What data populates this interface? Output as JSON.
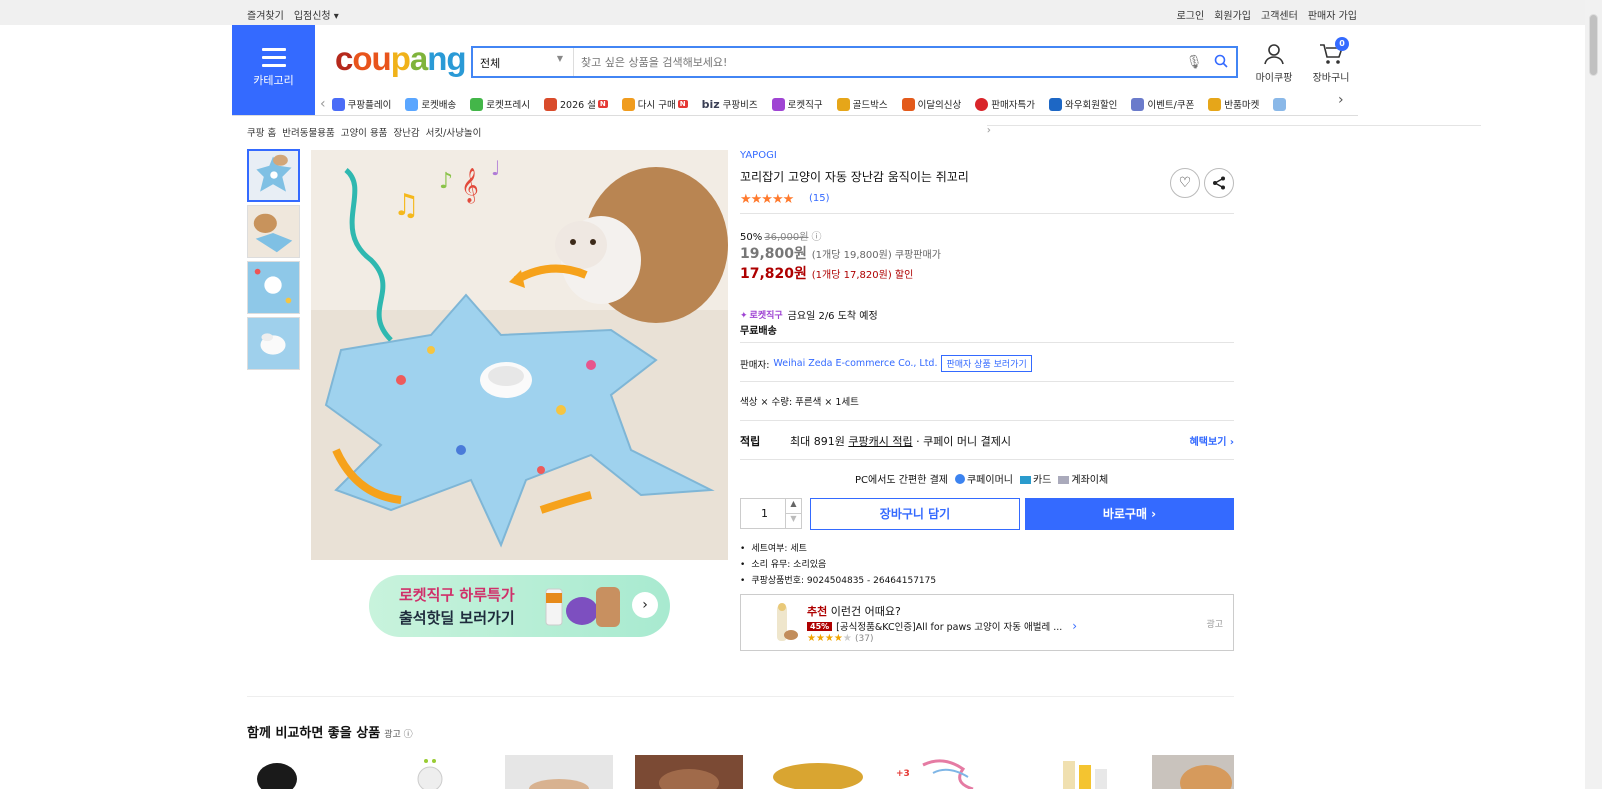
{
  "topbar": {
    "left": [
      "즐겨찾기",
      "입점신청 ▾"
    ],
    "right": [
      "로그인",
      "회원가입",
      "고객센터",
      "판매자 가입"
    ]
  },
  "category": {
    "label": "카테고리"
  },
  "search": {
    "scope": "전체",
    "placeholder": "찾고 싶은 상품을 검색해보세요!"
  },
  "header": {
    "my": "마이쿠팡",
    "cart": "장바구니",
    "cart_count": "0"
  },
  "quicknav": [
    {
      "label": "쿠팡플레이",
      "color": "#4a6cf7"
    },
    {
      "label": "로켓배송",
      "color": "#5aa6ff"
    },
    {
      "label": "로켓프레시",
      "color": "#43b649"
    },
    {
      "label": "2026 설",
      "color": "#d94b2b",
      "badge": "N"
    },
    {
      "label": "다시 구매",
      "color": "#f09c1e",
      "badge": "N"
    },
    {
      "label": "쿠팡비즈",
      "color": "#3a3f55",
      "prefix": "biz"
    },
    {
      "label": "로켓직구",
      "color": "#9f44d3"
    },
    {
      "label": "골드박스",
      "color": "#e6a619"
    },
    {
      "label": "이달의신상",
      "color": "#e35a1b"
    },
    {
      "label": "판매자특가",
      "color": "#d9252a"
    },
    {
      "label": "와우회원할인",
      "color": "#1d67c5"
    },
    {
      "label": "이벤트/쿠폰",
      "color": "#6b7bcb"
    },
    {
      "label": "반품마켓",
      "color": "#e6a619"
    }
  ],
  "breadcrumb": [
    "쿠팡 홈",
    "반려동물용품",
    "고양이 용품",
    "장난감",
    "서킷/사냥놀이"
  ],
  "promo": {
    "line1": "로켓직구 하루특가",
    "line2": "출석핫딜 보러가기"
  },
  "product": {
    "brand": "YAPOGI",
    "title": "꼬리잡기 고양이 자동 장난감 움직이는 쥐꼬리",
    "stars": "★★★★★",
    "review_count": "(15)",
    "discount_pct": "50%",
    "orig_price": "36,000원",
    "info_icon": "ⓘ",
    "price1": "19,800원",
    "price1_sub": "(1개당 19,800원) 쿠팡판매가",
    "price2": "17,820원",
    "price2_sub": "(1개당 17,820원) 할인",
    "rocket_tag": "로켓직구",
    "delivery": "금요일 2/6 도착 예정",
    "free_ship": "무료배송",
    "seller_label": "판매자:",
    "seller_name": "Weihai Zeda E-commerce Co., Ltd.",
    "seller_btn": "판매자 상품 보러가기",
    "option": "색상 × 수량: 푸른색 × 1세트",
    "reward_label": "적립",
    "reward_pre": "최대 891원",
    "reward_link": "쿠팡캐시 적립",
    "reward_post": " · 쿠페이 머니 결제시",
    "reward_more": "혜택보기 ›",
    "pay_pc": "PC에서도 간편한 결제",
    "pay_methods": [
      "쿠페이머니",
      "카드",
      "계좌이체"
    ],
    "qty": "1",
    "add_cart": "장바구니 담기",
    "buy_now": "바로구매 ›",
    "specs": [
      "세트여부: 세트",
      "소리 유무: 소리있음",
      "쿠팡상품번호: 9024504835 - 26464157175"
    ]
  },
  "recommend": {
    "label_red": "추천",
    "label_rest": " 이런건 어때요?",
    "pct": "45%",
    "name": "[공식정품&KC인증]All for paws 고양이 자동 애벌레 ...",
    "stars": "★★★★",
    "stars_empty": "★",
    "count": "(37)",
    "ad": "광고"
  },
  "compare": {
    "title": "함께 비교하면 좋을 상품",
    "ad": "광고 ⓘ",
    "extra": "+3"
  }
}
